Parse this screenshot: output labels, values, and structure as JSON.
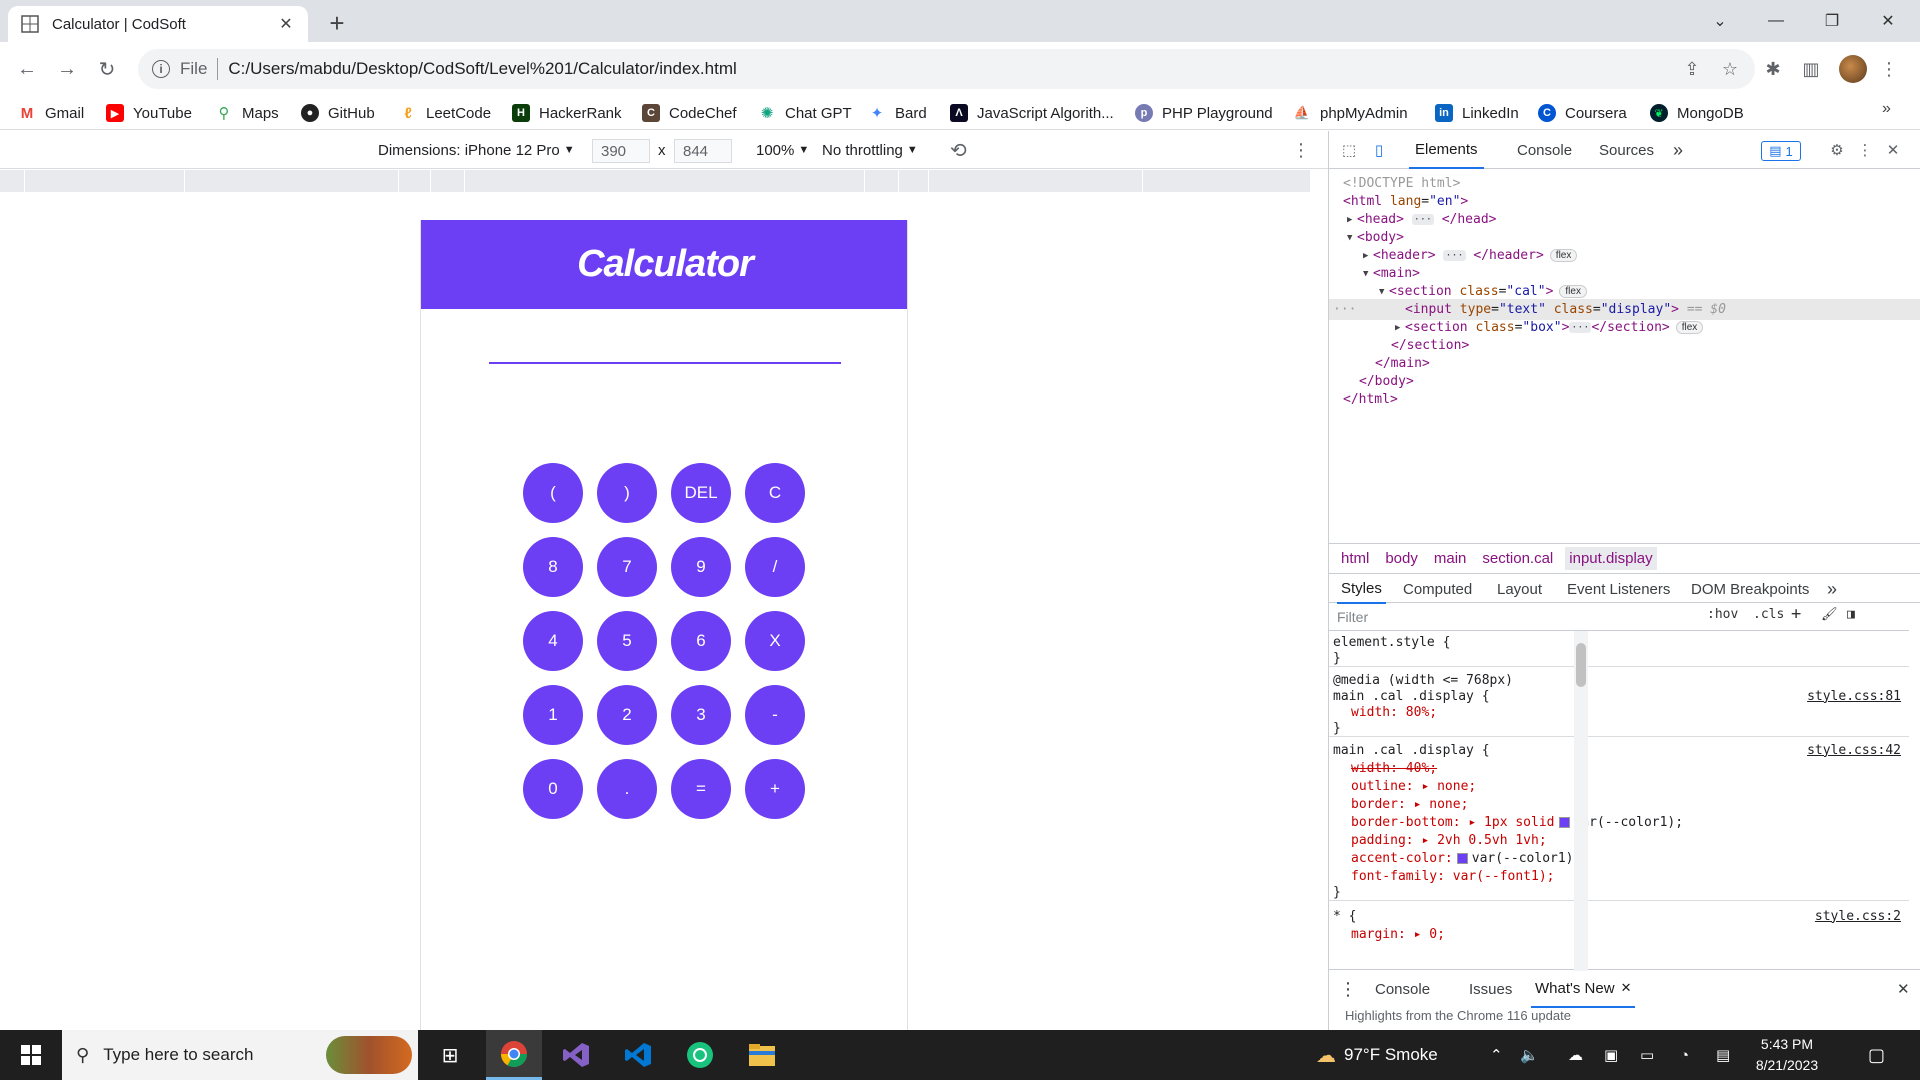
{
  "browser": {
    "tab_title": "Calculator | CodSoft",
    "url_scheme": "File",
    "url": "C:/Users/mabdu/Desktop/CodSoft/Level%201/Calculator/index.html",
    "new_tab_label": "+",
    "bookmarks": [
      "Gmail",
      "YouTube",
      "Maps",
      "GitHub",
      "LeetCode",
      "HackerRank",
      "CodeChef",
      "Chat GPT",
      "Bard",
      "JavaScript Algorith...",
      "PHP Playground",
      "phpMyAdmin",
      "LinkedIn",
      "Coursera",
      "MongoDB"
    ],
    "bookmarks_more": "»"
  },
  "device_toolbar": {
    "dimensions": "Dimensions: iPhone 12 Pro",
    "width": "390",
    "times": "x",
    "height": "844",
    "zoom": "100%",
    "throttling": "No throttling"
  },
  "calculator": {
    "title": "Calculator",
    "keys": [
      "(",
      ")",
      "DEL",
      "C",
      "8",
      "7",
      "9",
      "/",
      "4",
      "5",
      "6",
      "X",
      "1",
      "2",
      "3",
      "-",
      "0",
      ".",
      "=",
      "+"
    ]
  },
  "devtools": {
    "tabs": [
      "Elements",
      "Console",
      "Sources"
    ],
    "more_tabs": "»",
    "issues_count": "1",
    "dom": {
      "doctype": "<!DOCTYPE html>",
      "html_open": "<html",
      "html_lang_attr": "lang",
      "html_lang_val": "\"en\"",
      "head": "<head>",
      "head_close": "</head>",
      "body_open": "<body>",
      "header_open": "<header>",
      "header_close": "</header>",
      "main_open": "<main>",
      "section_open": "<section",
      "class_attr": "class",
      "cal_val": "\"cal\"",
      "input_open": "<input",
      "type_attr": "type",
      "type_val": "\"text\"",
      "display_val": "\"display\"",
      "eq_dollar": "== $0",
      "box_val": "\"box\"",
      "section_close": "</section>",
      "main_close": "</main>",
      "body_close": "</body>",
      "html_close": "</html>",
      "flex_chip": "flex",
      "ellipsis": "···",
      "gt": ">"
    },
    "breadcrumbs": [
      "html",
      "body",
      "main",
      "section.cal",
      "input.display"
    ],
    "style_tabs": [
      "Styles",
      "Computed",
      "Layout",
      "Event Listeners",
      "DOM Breakpoints"
    ],
    "filter_placeholder": "Filter",
    "filter_buttons": [
      ":hov",
      ".cls",
      "+"
    ],
    "styles": {
      "element_style": "element.style {",
      "close_brace": "}",
      "media": "@media (width <= 768px)",
      "selector": "main .cal .display {",
      "src1": "style.css:81",
      "width_80": "width: 80%;",
      "src2": "style.css:42",
      "width_40": "width: 40%;",
      "outline": "outline: ▸ none;",
      "border": "border: ▸ none;",
      "border_bottom_pre": "border-bottom: ▸ 1px solid",
      "var_color": "var(--color1);",
      "padding": "padding: ▸ 2vh 0.5vh 1vh;",
      "accent_pre": "accent-color:",
      "font_family": "font-family: var(--font1);",
      "star": "* {",
      "src3": "style.css:2",
      "margin": "margin: ▸ 0;"
    },
    "drawer_tabs": [
      "Console",
      "Issues",
      "What's New"
    ],
    "drawer_hint": "Highlights from the Chrome 116 update"
  },
  "taskbar": {
    "search_placeholder": "Type here to search",
    "weather": "97°F Smoke",
    "time": "5:43 PM",
    "date": "8/21/2023"
  },
  "colors": {
    "accent": "#6c3ef4",
    "devtools_tab_active": "#1a73e8",
    "taskbar": "#1f1f1f"
  }
}
